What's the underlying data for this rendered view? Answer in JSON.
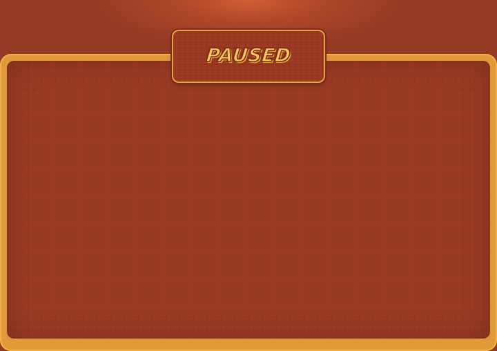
{
  "pause_screen": {
    "title": "PAUSED"
  },
  "colors": {
    "background": "#953a24",
    "glow": "#d35f35",
    "frame": "#e19a3a",
    "panel": "#9b3b23",
    "title_fill": "#f6c75e",
    "title_outline": "#7a2e18"
  }
}
